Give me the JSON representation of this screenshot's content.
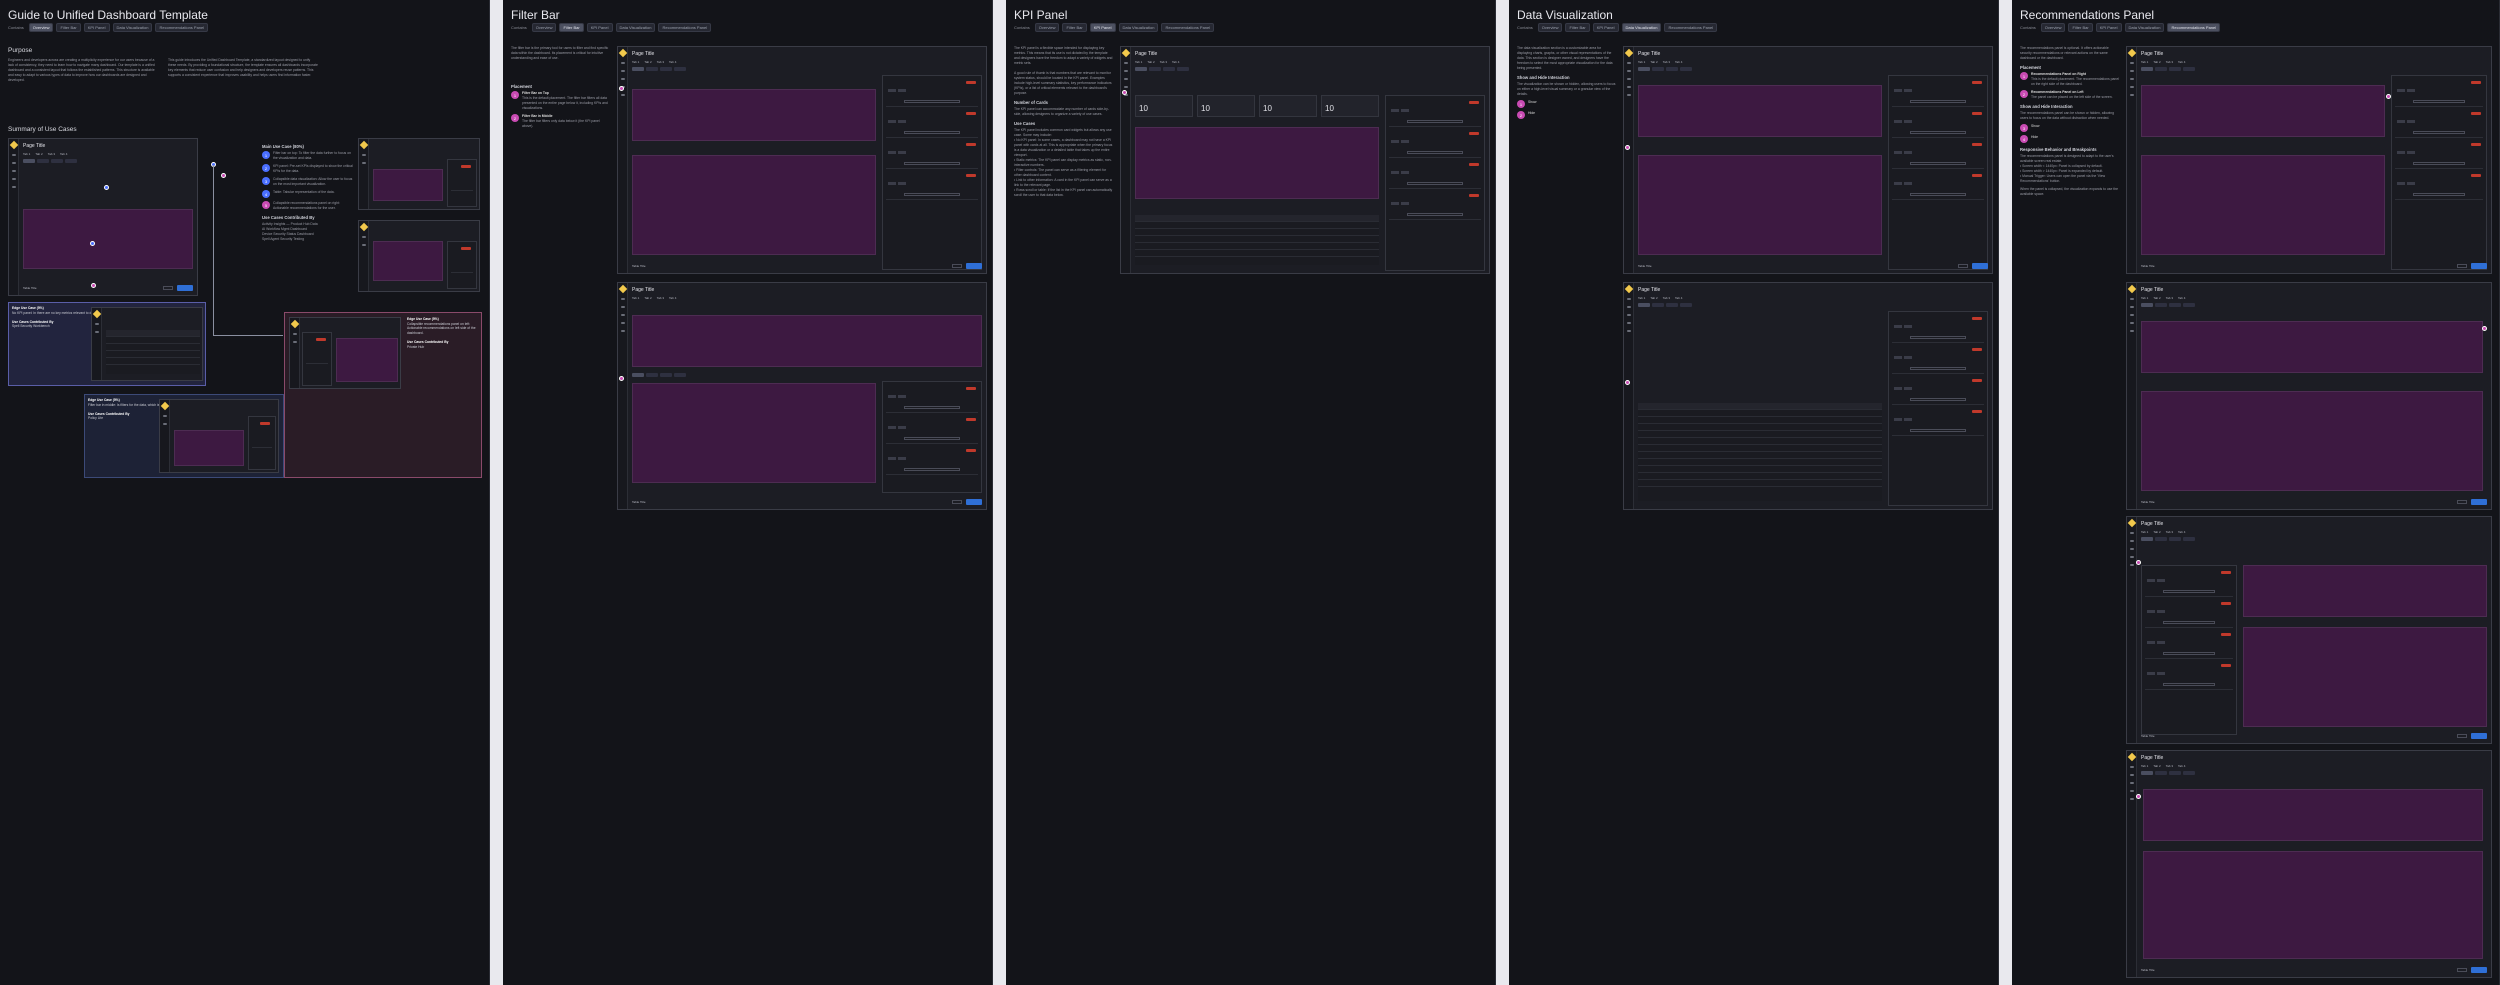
{
  "panels": [
    {
      "title": "Guide to Unified Dashboard Template",
      "tags_label": "Contains",
      "tags": [
        "Overview",
        "Filter Bar",
        "KPI Panel",
        "Data Visualization",
        "Recommendations Panel"
      ],
      "active_tag": 0,
      "sections": {
        "purpose_heading": "Purpose",
        "purpose_text": "Engineers and developers across are creating a multiplicity experience for our users because of a lack of consistency, they need to learn how to navigate many dashboard. Our template is a unified dashboard and a consistent layout that follows the established patterns. This structure is available and easy to adapt to various types of data to improve how our dashboards are designed and developed.",
        "purpose_text_2": "This guide introduces the Unified Dashboard Template, a standardized layout designed to unify these needs. By providing a foundational structure, the template ensures all dashboards incorporate key elements that reduce user confusion and help designers and developers reuse patterns. This supports a consistent experience that improves usability and helps users find information faster.",
        "summary_heading": "Summary of Use Cases",
        "usecases_heading": "Main Use Case (80%)",
        "usecases": [
          "Filter bar on top: To filter the data further to focus on the visualization and data.",
          "KPI panel: Pre-set KPIs displayed to show the critical KPIs for the data.",
          "Collapsible data visualization: Allow the user to focus on the most important visualization.",
          "Table: Tabular representation of the data.",
          "Collapsible recommendations panel on right: Actionable recommendations for the user."
        ],
        "examples_heading": "Use Cases Contributed By",
        "examples": [
          "Activity Insights — Product Hub Data",
          "AI Workflow Mgmt Dashboard",
          "Device Security Status Dashboard",
          "Spell Agent Security Testing"
        ],
        "edge1_title": "Edge Use Case (5%)",
        "edge1_text": "No KPI panel: In there are no key metrics relevant to display.",
        "edge1_sub": "Use Cases Contributed By",
        "edge1_item": "Spell Security Workbench",
        "edge2_title": "Edge Use Case (5%)",
        "edge2_text": "Filter bar in middle: Is filters for the data, which is in the lower part of the dashboard.",
        "edge2_sub": "Use Cases Contributed By",
        "edge2_item": "Policy Lite",
        "edge3_title": "Edge Use Case (5%)",
        "edge3_text": "Collapsible recommendations panel on left: Actionable recommendations on left side of the dashboard.",
        "edge3_sub": "Use Cases Contributed By",
        "edge3_item": "Private Hub"
      }
    },
    {
      "title": "Filter Bar",
      "tags_label": "Contains",
      "tags": [
        "Overview",
        "Filter Bar",
        "KPI Panel",
        "Data Visualization",
        "Recommendations Panel"
      ],
      "active_tag": 1,
      "intro": "The filter bar is the primary tool for users to filter and find specific data within the dashboard. Its placement is critical for intuitive understanding and ease of use.",
      "placement_heading": "Placement",
      "items": [
        {
          "label": "Filter Bar on Top",
          "desc": "This is the default placement. The filter bar filters all data presented on the entire page below it, including KPIs and visualizations."
        },
        {
          "label": "Filter Bar in Middle",
          "desc": "The filter bar filters only data below it (the KPI panel above)."
        }
      ]
    },
    {
      "title": "KPI Panel",
      "tags_label": "Contains",
      "tags": [
        "Overview",
        "Filter Bar",
        "KPI Panel",
        "Data Visualization",
        "Recommendations Panel"
      ],
      "active_tag": 2,
      "intro": "The KPI panel is a flexible space intended for displaying key metrics. This means that its use is not dictated by the template and designers have the freedom to adapt a variety of widgets and metric sets.",
      "intro_2": "A good rule of thumb is that numbers that are relevant to monitor system status, should be located in the KPI panel. Examples include high-level summary statistics, key performance indicators (KPIs), or a list of critical elements relevant to the dashboard's purpose.",
      "kpi_heading": "Number of Cards",
      "kpi_text": "The KPI panel can accommodate any number of cards side-by-side, allowing designers to organize a variety of use cases.",
      "use_heading": "Use Cases",
      "use_text": "The KPI panel includes common card widgets but allows any use case. Some may include:",
      "bullets": [
        "No KPI panel: In some cases, a dashboard may not have a KPI panel with cards at all. This is appropriate when the primary focus is a data visualization or a detailed table that takes up the entire viewport.",
        "Static metrics: The KPI panel can display metrics as static, non-interactive numbers.",
        "Filter controls: The panel can serve as a filtering element for other dashboard content.",
        "Link to other information: A card in the KPI panel can serve as a link to the relevant page.",
        "Rows scroll or table: If the list in the KPI panel can automatically scroll the user to that data below."
      ],
      "kpi_values": [
        "10",
        "10",
        "10",
        "10"
      ]
    },
    {
      "title": "Data Visualization",
      "tags_label": "Contains",
      "tags": [
        "Overview",
        "Filter Bar",
        "KPI Panel",
        "Data Visualization",
        "Recommendations Panel"
      ],
      "active_tag": 3,
      "intro": "The data visualization section is a customizable area for displaying charts, graphs, or other visual representations of the data. This section is designer owned, and designers have the freedom to select the most appropriate visualization for the data being presented.",
      "sub_heading": "Show and Hide Interaction",
      "sub_text": "The visualization can be shown or hidden, allowing users to focus on either a high-level visual summary or a granular view of the details.",
      "items": [
        "Show",
        "Hide"
      ]
    },
    {
      "title": "Recommendations Panel",
      "tags_label": "Contains",
      "tags": [
        "Overview",
        "Filter Bar",
        "KPI Panel",
        "Data Visualization",
        "Recommendations Panel"
      ],
      "active_tag": 4,
      "intro": "The recommendations panel is optional. It offers actionable security recommendations or relevant actions on the same dashboard or the dashboard.",
      "placement_heading": "Placement",
      "items": [
        {
          "label": "Recommendations Panel on Right",
          "desc": "This is the default placement. The recommendations panel on the right side of the dashboard."
        },
        {
          "label": "Recommendations Panel on Left",
          "desc": "The panel can be placed on the left side of the screen."
        }
      ],
      "sh_heading": "Show and Hide Interaction",
      "sh_text": "The recommendations panel can be shown or hidden, allowing users to focus on the data without distraction when needed.",
      "sh_items": [
        "Show",
        "Hide"
      ],
      "resp_heading": "Responsive Behavior and Breakpoints",
      "resp_text": "The recommendations panel is designed to adapt to the user's available screen real estate.",
      "resp_bullets": [
        "Screen width < 1440px: Panel is collapsed by default.",
        "Screen width > 1440px: Panel is expanded by default.",
        "Manual Trigger: Users can open the panel via the 'View Recommendations' button."
      ],
      "resp_text_2": "When the panel is collapsed, the visualization expands to use the available space."
    }
  ],
  "dash": {
    "page_title": "Page Title",
    "tabs": [
      "Tab 1",
      "Tab 2",
      "Tab 3",
      "Tab 4"
    ],
    "table_title": "Table Title",
    "recs_title": "Recommendations"
  }
}
